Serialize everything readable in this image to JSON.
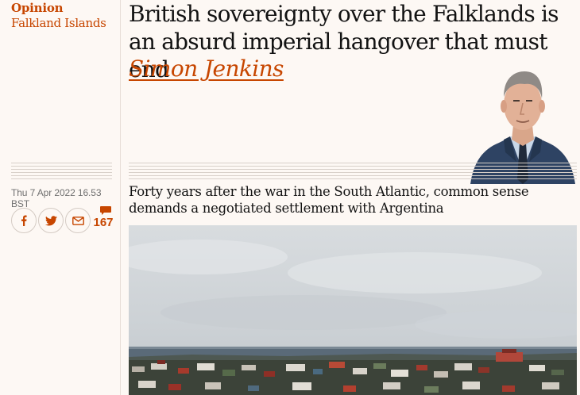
{
  "section": "Opinion",
  "subsection": "Falkland Islands",
  "headline": "British sovereignty over the Falklands is an absurd imperial hangover that must end",
  "byline": "Simon Jenkins",
  "dateline": "Thu 7 Apr 2022 16.53 BST",
  "standfirst": "Forty years after the war in the South Atlantic, common sense demands a negotiated settlement with Argentina",
  "share": {
    "facebook_icon": "facebook-icon",
    "twitter_icon": "twitter-icon",
    "email_icon": "email-icon"
  },
  "comments": {
    "icon": "comment-bubble-icon",
    "count": "167"
  },
  "colors": {
    "accent": "#c74600",
    "background": "#fdf8f4",
    "text": "#121212",
    "meta": "#707070"
  }
}
